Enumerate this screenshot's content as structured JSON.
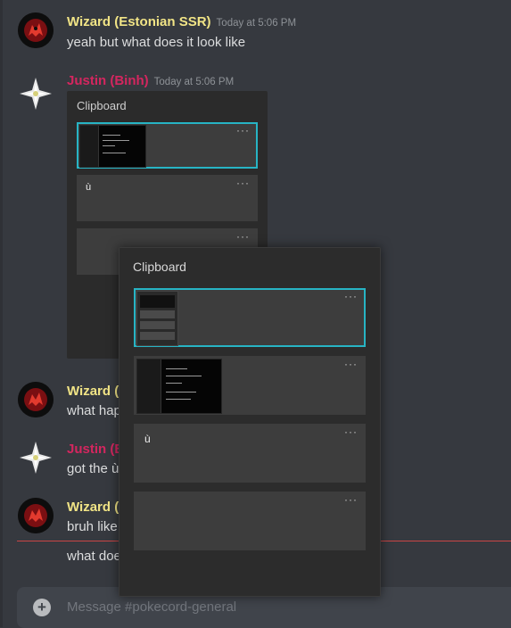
{
  "messages": [
    {
      "author": "Wizard (Estonian SSR)",
      "time": "Today at 5:06 PM",
      "text": "yeah but what does it look like"
    },
    {
      "author": "Justin (Binh)",
      "time": "Today at 5:06 PM"
    },
    {
      "author": "Wizard (",
      "text": "what hap"
    },
    {
      "author": "Justin (B",
      "text": "got the ù"
    },
    {
      "author": "Wizard (",
      "text": "bruh like"
    },
    {
      "text": "what doe"
    }
  ],
  "clipboard_embed": {
    "title": "Clipboard",
    "items": [
      {
        "kind": "screenshot",
        "selected": true
      },
      {
        "kind": "text",
        "value": "ù"
      },
      {
        "kind": "empty"
      }
    ]
  },
  "clipboard_panel": {
    "title": "Clipboard",
    "more_label": "···",
    "items": [
      {
        "kind": "screenshot-stack",
        "selected": true
      },
      {
        "kind": "screenshot-terminal"
      },
      {
        "kind": "text",
        "value": "ù"
      },
      {
        "kind": "empty"
      }
    ]
  },
  "composer": {
    "placeholder": "Message #pokecord-general",
    "plus_label": "+"
  },
  "colors": {
    "background": "#36393f",
    "wizard_name": "#f1e486",
    "justin_name": "#d4265f",
    "selection_accent": "#27b4c4",
    "new_messages_line": "#c94545"
  }
}
